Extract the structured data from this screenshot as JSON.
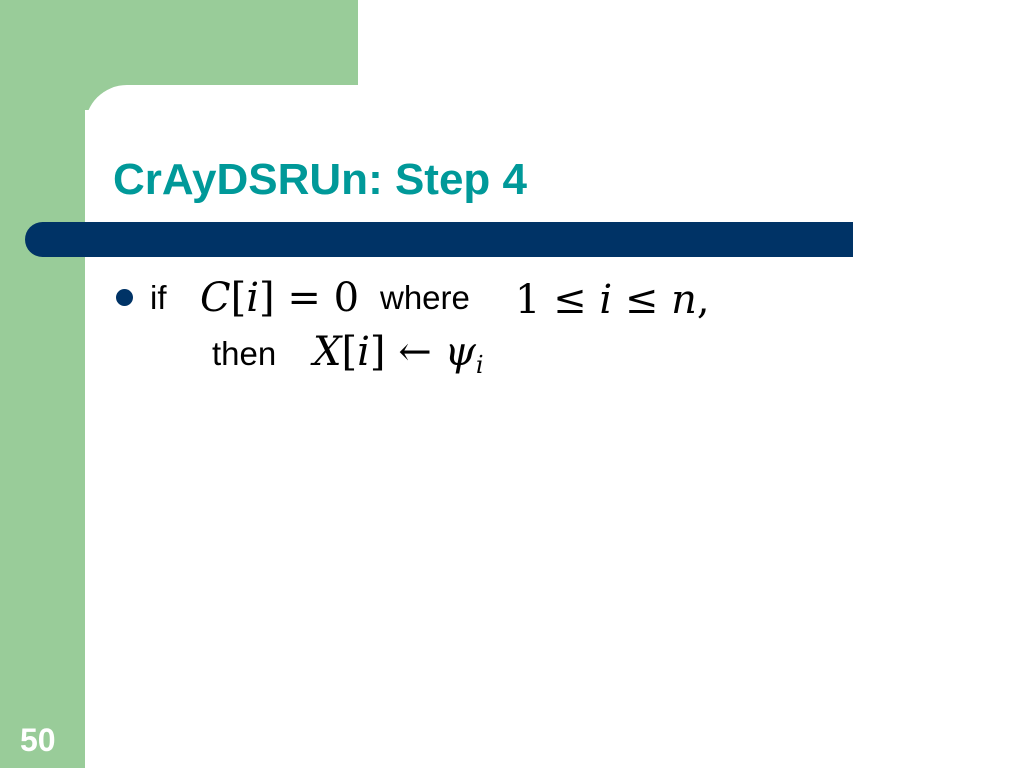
{
  "slide": {
    "title": "CrAyDSRUn: Step 4",
    "number": "50",
    "colors": {
      "background_panel": "#99cc99",
      "title": "#009999",
      "title_bar": "#003366",
      "bullet": "#003366",
      "text": "#000000"
    },
    "bullet": {
      "line1": {
        "if_word": "if",
        "condition_math": {
          "C": "C",
          "open": "[",
          "i": "i",
          "close": "]",
          "op": " = ",
          "zero": "0"
        },
        "where_word": "where",
        "range_math": {
          "one": "1",
          "le1": " ≤ ",
          "i": "i",
          "le2": " ≤ ",
          "n": "n",
          "comma": ","
        }
      },
      "line2": {
        "then_word": "then",
        "assign_math": {
          "X": "X",
          "open": "[",
          "i": "i",
          "close": "]",
          "arrow": " ← ",
          "psi": "ψ",
          "sub": "i"
        }
      }
    }
  }
}
